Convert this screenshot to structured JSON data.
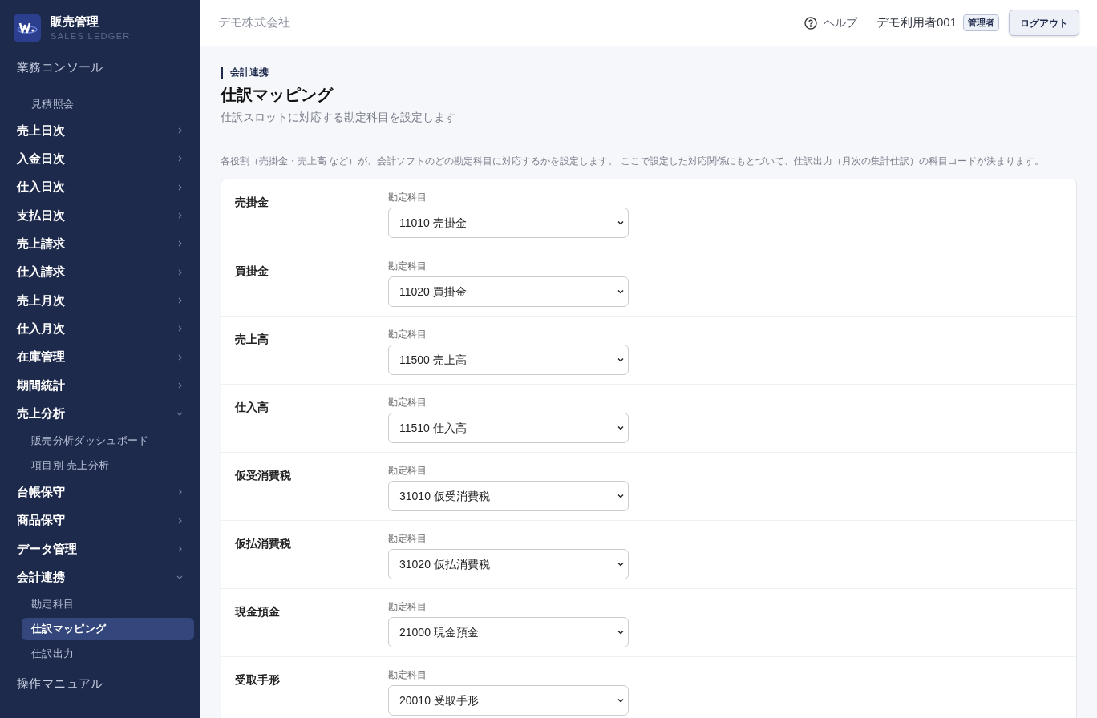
{
  "brand": {
    "title": "販売管理",
    "subtitle": "SALES LEDGER"
  },
  "sidebar": {
    "heading": "業務コンソール",
    "top_children": [
      {
        "label": "見積照会",
        "selected": false
      }
    ],
    "groups": [
      {
        "label": "売上日次",
        "expanded": false
      },
      {
        "label": "入金日次",
        "expanded": false
      },
      {
        "label": "仕入日次",
        "expanded": false
      },
      {
        "label": "支払日次",
        "expanded": false
      },
      {
        "label": "売上請求",
        "expanded": false
      },
      {
        "label": "仕入請求",
        "expanded": false
      },
      {
        "label": "売上月次",
        "expanded": false
      },
      {
        "label": "仕入月次",
        "expanded": false
      },
      {
        "label": "在庫管理",
        "expanded": false
      },
      {
        "label": "期間統計",
        "expanded": false
      },
      {
        "label": "売上分析",
        "expanded": true,
        "children": [
          {
            "label": "販売分析ダッシュボード",
            "selected": false
          },
          {
            "label": "項目別 売上分析",
            "selected": false
          }
        ]
      },
      {
        "label": "台帳保守",
        "expanded": false
      },
      {
        "label": "商品保守",
        "expanded": false
      },
      {
        "label": "データ管理",
        "expanded": false
      },
      {
        "label": "会計連携",
        "expanded": true,
        "children": [
          {
            "label": "勘定科目",
            "selected": false
          },
          {
            "label": "仕訳マッピング",
            "selected": true
          },
          {
            "label": "仕訳出力",
            "selected": false
          }
        ]
      }
    ],
    "footer": "操作マニュアル"
  },
  "header": {
    "company": "デモ株式会社",
    "help": "ヘルプ",
    "user": "デモ利用者001",
    "role": "管理者",
    "logout": "ログアウト"
  },
  "page": {
    "section": "会計連携",
    "title": "仕訳マッピング",
    "subtitle": "仕訳スロットに対応する勘定科目を設定します",
    "description": "各役割（売掛金・売上高 など）が、会計ソフトのどの勘定科目に対応するかを設定します。 ここで設定した対応関係にもとづいて、仕訳出力（月次の集計仕訳）の科目コードが決まります。"
  },
  "mappings": [
    {
      "slot": "売掛金",
      "field_label": "勘定科目",
      "value": "11010 売掛金"
    },
    {
      "slot": "買掛金",
      "field_label": "勘定科目",
      "value": "11020 買掛金"
    },
    {
      "slot": "売上高",
      "field_label": "勘定科目",
      "value": "11500 売上高"
    },
    {
      "slot": "仕入高",
      "field_label": "勘定科目",
      "value": "11510 仕入高"
    },
    {
      "slot": "仮受消費税",
      "field_label": "勘定科目",
      "value": "31010 仮受消費税"
    },
    {
      "slot": "仮払消費税",
      "field_label": "勘定科目",
      "value": "31020 仮払消費税"
    },
    {
      "slot": "現金預金",
      "field_label": "勘定科目",
      "value": "21000 現金預金"
    },
    {
      "slot": "受取手形",
      "field_label": "勘定科目",
      "value": "20010 受取手形"
    }
  ]
}
